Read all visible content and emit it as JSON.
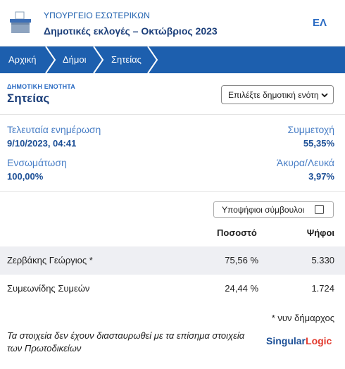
{
  "header": {
    "ministry": "ΥΠΟΥΡΓΕΙΟ ΕΣΩΤΕΡΙΚΩΝ",
    "election_title": "Δημοτικές εκλογές – Οκτώβριος 2023",
    "language": "ΕΛ"
  },
  "breadcrumb": [
    "Αρχική",
    "Δήμοι",
    "Σητείας"
  ],
  "municipality": {
    "subtitle": "ΔΗΜΟΤΙΚΗ ΕΝΟΤΗΤΑ",
    "name": "Σητείας",
    "unit_select": "Επιλέξτε δημοτική ενότητα"
  },
  "stats": {
    "last_update_label": "Τελευταία ενημέρωση",
    "last_update_value": "9/10/2023, 04:41",
    "turnout_label": "Συμμετοχή",
    "turnout_value": "55,35%",
    "integration_label": "Ενσωμάτωση",
    "integration_value": "100,00%",
    "invalid_label": "Άκυρα/Λευκά",
    "invalid_value": "3,97%"
  },
  "candidates_toggle": {
    "label": "Υποψήφιοι σύμβουλοι",
    "checked": false
  },
  "table": {
    "col_percent": "Ποσοστό",
    "col_votes": "Ψήφοι",
    "rows": [
      {
        "name": "Ζερβάκης Γεώργιος *",
        "percent": "75,56 %",
        "votes": "5.330"
      },
      {
        "name": "Συμεωνίδης Συμεών",
        "percent": "24,44 %",
        "votes": "1.724"
      }
    ]
  },
  "footnote": "* νυν δήμαρχος",
  "disclaimer": "Τα στοιχεία δεν έχουν διασταυρωθεί με τα επίσημα στοιχεία των Πρωτοδικείων",
  "logo": {
    "part1": "Singular",
    "part2": "Logic"
  },
  "colors": {
    "primary": "#1d5fae",
    "dark_blue": "#1c3f7a",
    "logo_red": "#e23a2e",
    "row_shade": "#eeeff3"
  }
}
